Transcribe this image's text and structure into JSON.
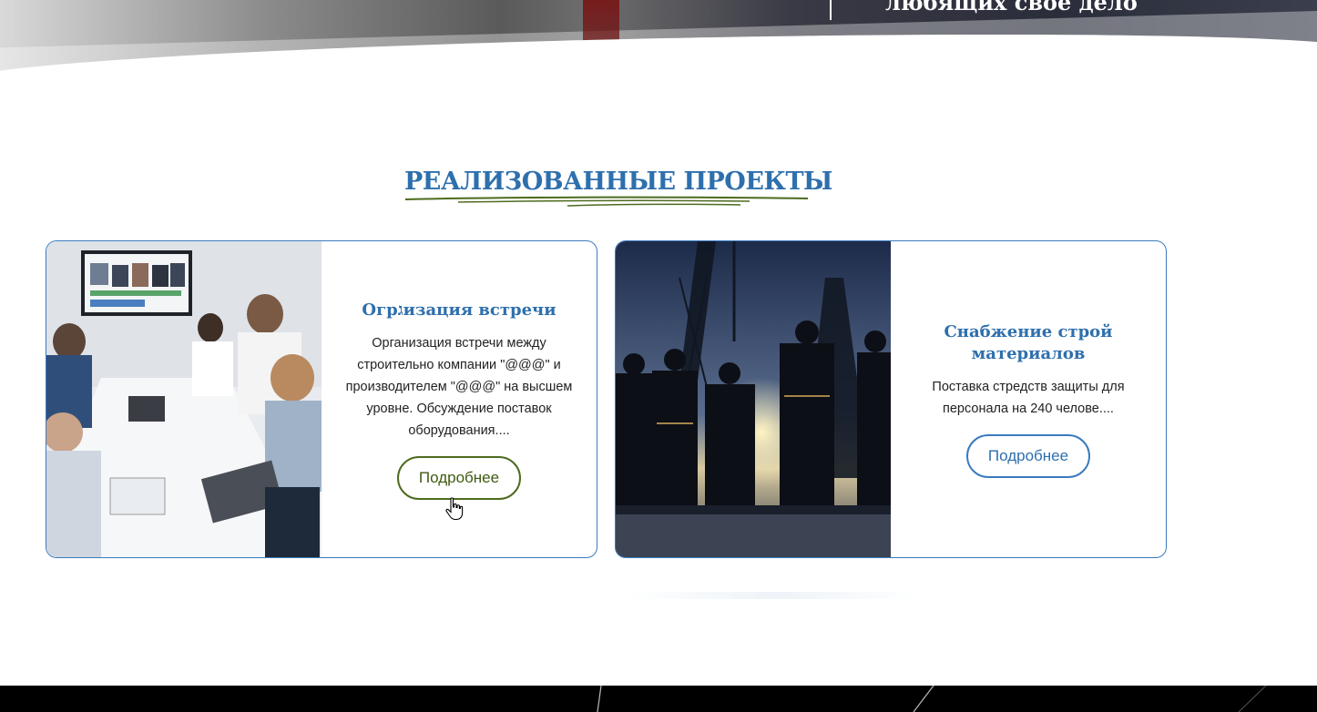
{
  "hero": {
    "tagline": "любящих свое дело"
  },
  "section": {
    "title": "РЕАЛИЗОВАННЫЕ ПРОЕКТЫ"
  },
  "projects": [
    {
      "title": "Огрגизация встречи",
      "description": "Организация встречи между строительно компании \"@@@\" и производителем \"@@@\" на высшем уровне. Обсуждение поставок оборудования....",
      "button_label": "Подробнее",
      "image": "meeting-room-photo"
    },
    {
      "title": "Снабжение строй материалов",
      "description": "Поставка стредств защиты для персонала на 240 челове....",
      "button_label": "Подробнее",
      "image": "construction-workers-photo"
    }
  ],
  "colors": {
    "accent_blue": "#2e6fad",
    "accent_green": "#4e6b1f",
    "card_border": "#3a7bbf"
  }
}
